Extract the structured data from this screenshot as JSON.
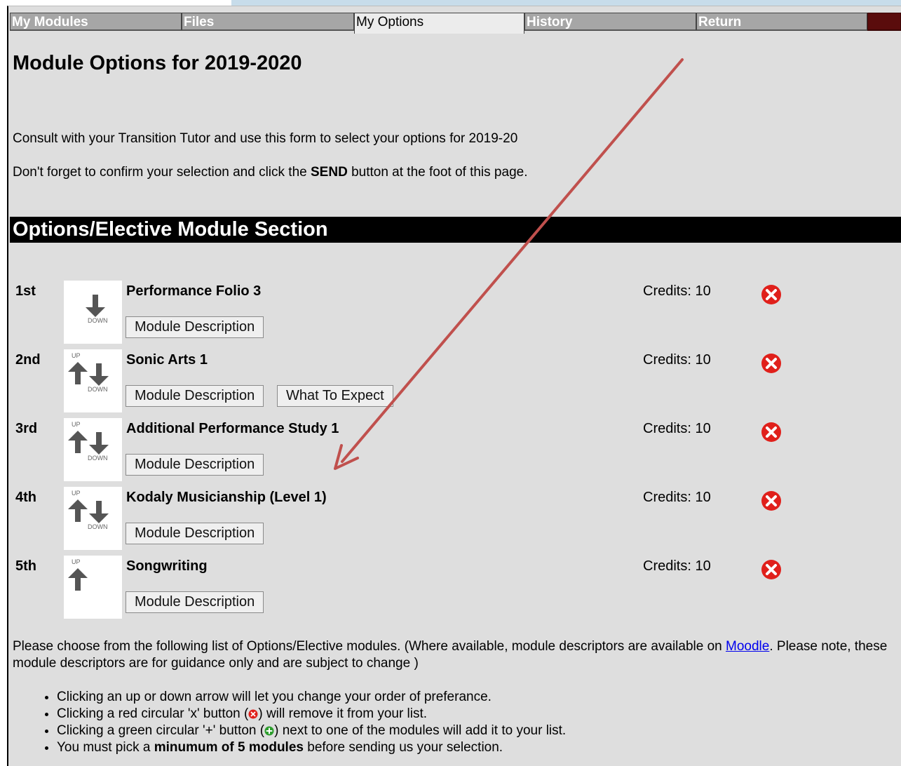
{
  "tabs": [
    {
      "label": "My Modules",
      "active": false
    },
    {
      "label": "Files",
      "active": false
    },
    {
      "label": "My Options",
      "active": true
    },
    {
      "label": "History",
      "active": false
    },
    {
      "label": "Return",
      "active": false
    }
  ],
  "page_title": "Module Options for 2019-2020",
  "intro": {
    "line1": "Consult with your Transition Tutor and use this form to select your options for 2019-20",
    "line2_prefix": "Don't forget to confirm your selection and click the ",
    "line2_bold": "SEND",
    "line2_suffix": " button at the foot of this page."
  },
  "section_title": "Options/Elective Module Section",
  "arrow_labels": {
    "up": "UP",
    "down": "DOWN"
  },
  "modules": [
    {
      "rank": "1st",
      "title": "Performance Folio 3",
      "credits": "Credits: 10",
      "buttons": [
        "Module Description"
      ]
    },
    {
      "rank": "2nd",
      "title": "Sonic Arts 1",
      "credits": "Credits: 10",
      "buttons": [
        "Module Description",
        "What To Expect"
      ]
    },
    {
      "rank": "3rd",
      "title": "Additional Performance Study 1",
      "credits": "Credits: 10",
      "buttons": [
        "Module Description"
      ]
    },
    {
      "rank": "4th",
      "title": "Kodaly Musicianship (Level 1)",
      "credits": "Credits: 10",
      "buttons": [
        "Module Description"
      ]
    },
    {
      "rank": "5th",
      "title": "Songwriting",
      "credits": "Credits: 10",
      "buttons": [
        "Module Description"
      ]
    }
  ],
  "choose_text": {
    "part1": "Please choose from the following list of Options/Elective modules. (Where available, module descriptors are available on ",
    "link": "Moodle",
    "part2": ". Please note, these module descriptors are for guidance only and are subject to change )"
  },
  "bullets": {
    "b1": "Clicking an up or down arrow will let you change your order of preferance.",
    "b2_pre": "Clicking a red circular 'x' button (",
    "b2_post": ") will remove it from your list.",
    "b3_pre": "Clicking a green circular '+' button (",
    "b3_post": ") next to one of the modules will add it to your list.",
    "b4_pre": "You must pick a ",
    "b4_bold": "minumum of 5 modules",
    "b4_post": " before sending us your selection."
  },
  "colors": {
    "remove_icon": "#e0201b",
    "add_icon": "#2e9e2e",
    "annotation_arrow": "#c0504d",
    "maroon_tab": "#5a0c0c"
  }
}
